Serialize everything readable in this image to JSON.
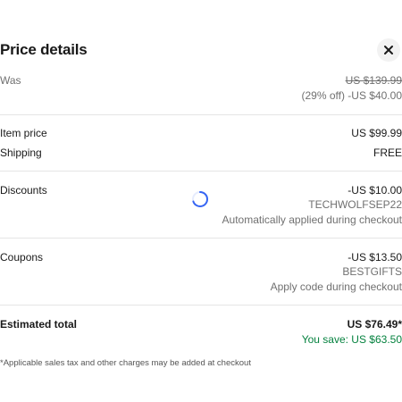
{
  "dialog": {
    "title": "Price details",
    "close_icon": "close-icon"
  },
  "was": {
    "label": "Was",
    "original_price": "US $139.99",
    "savings": "(29% off) -US $40.00"
  },
  "item": {
    "price_label": "Item price",
    "price_value": "US $99.99",
    "shipping_label": "Shipping",
    "shipping_value": "FREE"
  },
  "discounts": {
    "label": "Discounts",
    "amount": "-US $10.00",
    "code": "TECHWOLFSEP22",
    "note": "Automatically applied during checkout"
  },
  "coupons": {
    "label": "Coupons",
    "amount": "-US $13.50",
    "code": "BESTGIFTS",
    "note": "Apply code during checkout"
  },
  "total": {
    "label": "Estimated total",
    "value": "US $76.49*",
    "savings": "You save: US $63.50"
  },
  "footnote": "*Applicable sales tax and other charges may be added at checkout",
  "colors": {
    "accent_blue": "#3665f3",
    "savings_green": "#05823f",
    "divider": "#e5e5e5"
  },
  "loading_indicator": "spinner-icon"
}
